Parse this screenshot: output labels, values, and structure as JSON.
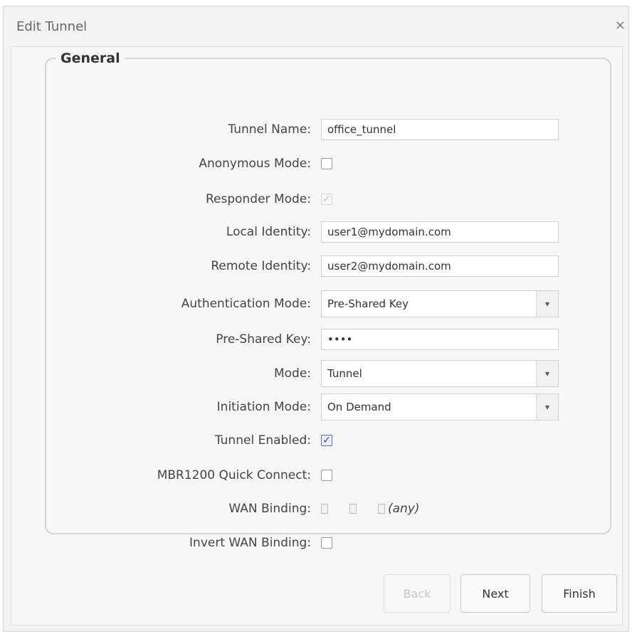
{
  "dialog": {
    "title": "Edit Tunnel",
    "close_label": "×"
  },
  "section": {
    "legend": "General"
  },
  "fields": {
    "tunnel_name": {
      "label": "Tunnel Name:",
      "value": "office_tunnel"
    },
    "anonymous_mode": {
      "label": "Anonymous Mode:",
      "checked": false
    },
    "responder_mode": {
      "label": "Responder Mode:",
      "checked": true,
      "disabled": true
    },
    "local_identity": {
      "label": "Local Identity:",
      "value": "user1@mydomain.com"
    },
    "remote_identity": {
      "label": "Remote Identity:",
      "value": "user2@mydomain.com"
    },
    "authentication_mode": {
      "label": "Authentication Mode:",
      "value": "Pre-Shared Key"
    },
    "pre_shared_key": {
      "label": "Pre-Shared Key:",
      "value": "••••"
    },
    "mode": {
      "label": "Mode:",
      "value": "Tunnel"
    },
    "initiation_mode": {
      "label": "Initiation Mode:",
      "value": "On Demand"
    },
    "tunnel_enabled": {
      "label": "Tunnel Enabled:",
      "checked": true
    },
    "mbr_quick_connect": {
      "label": "MBR1200 Quick Connect:",
      "checked": false
    },
    "wan_binding": {
      "label": "WAN Binding:",
      "any_label": "(any)"
    },
    "invert_wan_binding": {
      "label": "Invert WAN Binding:",
      "checked": false
    }
  },
  "buttons": {
    "back": "Back",
    "next": "Next",
    "finish": "Finish"
  },
  "icons": {
    "select_arrow": "chevron-down-icon",
    "check": "checkmark-icon",
    "close": "close-icon"
  }
}
